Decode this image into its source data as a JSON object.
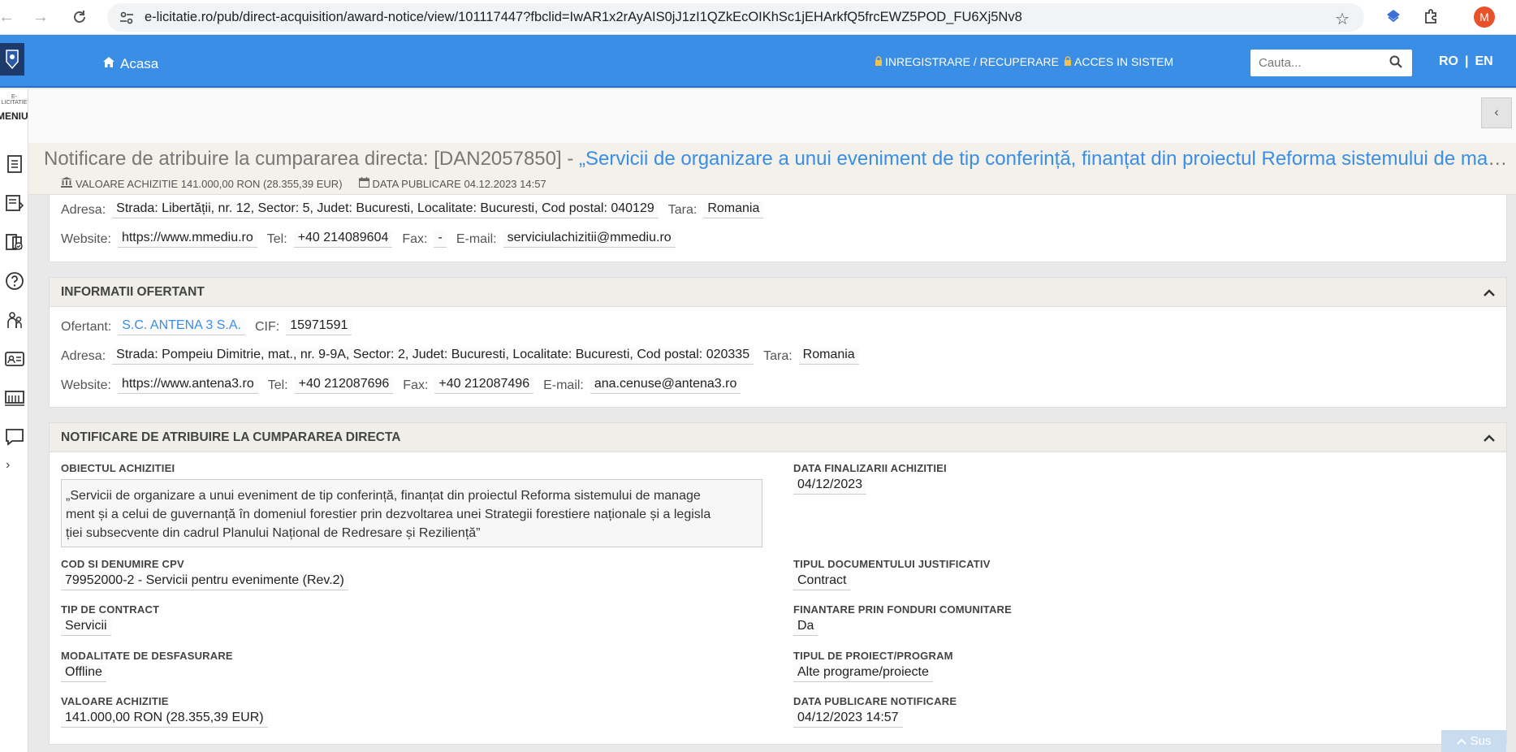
{
  "browser": {
    "url": "e-licitatie.ro/pub/direct-acquisition/award-notice/view/101117447?fbclid=IwAR1x2rAyAIS0jJ1zI1QZkEcOIKhSc1jEHArkfQ5frcEWZ5POD_FU6Xj5Nv8",
    "profile_initial": "M"
  },
  "appbar": {
    "home_label": "Acasa",
    "register_label": "INREGISTRARE / RECUPERARE",
    "login_label": "ACCES IN SISTEM",
    "search_placeholder": "Cauta...",
    "lang_ro": "RO",
    "lang_sep": "|",
    "lang_en": "EN"
  },
  "sidebar": {
    "brand_small": "E-LICITATIE",
    "menu_label": "MENIU"
  },
  "header": {
    "title_prefix": "Notificare de atribuire la cumpararea directa: [DAN2057850] - ",
    "title_link": "„Servicii de organizare a unui eveniment de tip conferință, finanțat din proiectul Reforma sistemului de management și a celui de guvernanță în domeniul forestier prin dezvoltarea unei Strategii forestiere naționale și a legislației subsecvente din cadrul Planului Național de Redresare și Reziliență”",
    "value_label": "VALOARE ACHIZITIE 141.000,00 RON (28.355,39 EUR)",
    "date_label": "DATA PUBLICARE 04.12.2023 14:57"
  },
  "authority": {
    "address_label": "Adresa:",
    "address": "Strada: Libertății, nr. 12, Sector: 5, Judet: Bucuresti, Localitate: Bucuresti, Cod postal: 040129",
    "country_label": "Tara:",
    "country": "Romania",
    "website_label": "Website:",
    "website": "https://www.mmediu.ro",
    "tel_label": "Tel:",
    "tel": "+40 214089604",
    "fax_label": "Fax:",
    "fax": "-",
    "email_label": "E-mail:",
    "email": "serviciulachizitii@mmediu.ro"
  },
  "bidder": {
    "heading": "INFORMATII OFERTANT",
    "bidder_label": "Ofertant:",
    "bidder_name": "S.C. ANTENA 3 S.A.",
    "cif_label": "CIF:",
    "cif": "15971591",
    "address_label": "Adresa:",
    "address": "Strada: Pompeiu Dimitrie, mat., nr. 9-9A, Sector: 2, Judet: Bucuresti, Localitate: Bucuresti, Cod postal: 020335",
    "country_label": "Tara:",
    "country": "Romania",
    "website_label": "Website:",
    "website": "https://www.antena3.ro",
    "tel_label": "Tel:",
    "tel": "+40 212087696",
    "fax_label": "Fax:",
    "fax": "+40 212087496",
    "email_label": "E-mail:",
    "email": "ana.cenuse@antena3.ro"
  },
  "notice": {
    "heading": "NOTIFICARE DE ATRIBUIRE LA CUMPARAREA DIRECTA",
    "object_label": "OBIECTUL ACHIZITIEI",
    "object_line1": "„Servicii de organizare a unui eveniment de tip conferință, finanțat din proiectul Reforma sistemului de manage",
    "object_line2": "ment și a celui de guvernanță în domeniul forestier prin dezvoltarea unei Strategii forestiere naționale și a legisla",
    "object_line3": "ției subsecvente din cadrul Planului Național de Redresare și Reziliență”",
    "end_date_label": "DATA FINALIZARII ACHIZITIEI",
    "end_date": "04/12/2023",
    "cpv_label": "COD SI DENUMIRE CPV",
    "cpv": "79952000-2 - Servicii pentru evenimente (Rev.2)",
    "doc_type_label": "TIPUL DOCUMENTULUI JUSTIFICATIV",
    "doc_type": "Contract",
    "contract_type_label": "TIP DE CONTRACT",
    "contract_type": "Servicii",
    "eu_funds_label": "FINANTARE PRIN FONDURI COMUNITARE",
    "eu_funds": "Da",
    "mode_label": "MODALITATE DE DESFASURARE",
    "mode": "Offline",
    "program_label": "TIPUL DE PROIECT/PROGRAM",
    "program": "Alte programe/proiecte",
    "value_label": "VALOARE ACHIZITIE",
    "value": "141.000,00 RON (28.355,39 EUR)",
    "pub_date_label": "DATA PUBLICARE NOTIFICARE",
    "pub_date": "04/12/2023 14:57"
  },
  "scroll_top_label": "Sus"
}
